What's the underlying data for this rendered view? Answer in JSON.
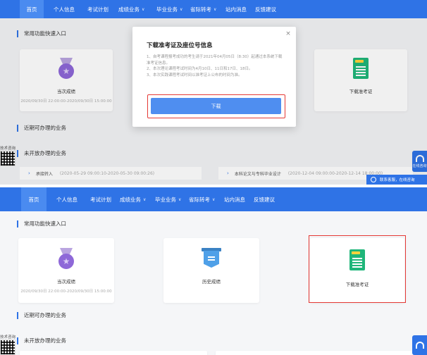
{
  "nav": {
    "items": [
      {
        "label": "首页",
        "active": true,
        "has_caret": false
      },
      {
        "label": "个人信息",
        "active": false,
        "has_caret": false
      },
      {
        "label": "考试计划",
        "active": false,
        "has_caret": false
      },
      {
        "label": "成绩业务",
        "active": false,
        "has_caret": true
      },
      {
        "label": "毕业业务",
        "active": false,
        "has_caret": true
      },
      {
        "label": "省际转考",
        "active": false,
        "has_caret": true
      },
      {
        "label": "站内消息",
        "active": false,
        "has_caret": false
      },
      {
        "label": "反馈建议",
        "active": false,
        "has_caret": false
      }
    ],
    "caret": "∨"
  },
  "sections": {
    "quick_entry": "常用功能快速入口",
    "recent": "近期可办理的业务",
    "not_open": "未开放办理的业务"
  },
  "cards": {
    "current_score": {
      "label": "当次成绩",
      "time": "2020/09/30日 22:00:00-2020/09/30日 15:00:00",
      "icon": "medal-icon"
    },
    "history_score": {
      "label": "历史成绩",
      "icon": "banner-icon"
    },
    "admission_ticket": {
      "label": "下载准考证",
      "icon": "ticket-icon",
      "tag": "准考证"
    }
  },
  "modal": {
    "title": "下载准考证及座位号信息",
    "close": "×",
    "notes": [
      "1、自考课程报考成功的考生请于2021年04月05日（8:30）起通过本系统下载准考证信息。",
      "2、本次理论课程考试时间为4月10日、11日和17日、18日。",
      "3、本次实践课程考试时间以准考证上公布的时间为准。"
    ],
    "download_label": "下载"
  },
  "not_open_items": [
    {
      "name": "承接转入",
      "time": "(2020-05-29 09:00:10-2020-05-30 09:00:26)"
    },
    {
      "name": "本科论文与专科毕业设计",
      "time": "(2020-12-04 09:00:00-2020-12-14 18:00:00)"
    }
  ],
  "widgets": {
    "qr_label": "技术咨询",
    "service_label": "在线咨询",
    "consult_label": "联系客服，在线咨询"
  },
  "colors": {
    "brand": "#2f73e6",
    "highlight": "#e53935"
  }
}
